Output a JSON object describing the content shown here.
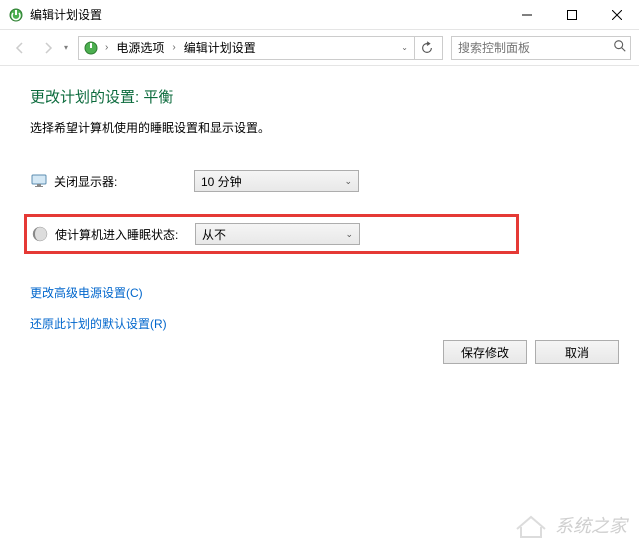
{
  "window": {
    "title": "编辑计划设置"
  },
  "breadcrumb": {
    "items": [
      "电源选项",
      "编辑计划设置"
    ]
  },
  "search": {
    "placeholder": "搜索控制面板"
  },
  "page": {
    "title": "更改计划的设置: 平衡",
    "description": "选择希望计算机使用的睡眠设置和显示设置。"
  },
  "settings": {
    "display_off": {
      "label": "关闭显示器:",
      "value": "10 分钟"
    },
    "sleep": {
      "label": "使计算机进入睡眠状态:",
      "value": "从不"
    }
  },
  "links": {
    "advanced": "更改高级电源设置(C)",
    "restore": "还原此计划的默认设置(R)"
  },
  "buttons": {
    "save": "保存修改",
    "cancel": "取消"
  },
  "watermark": {
    "text": "系统之家"
  }
}
